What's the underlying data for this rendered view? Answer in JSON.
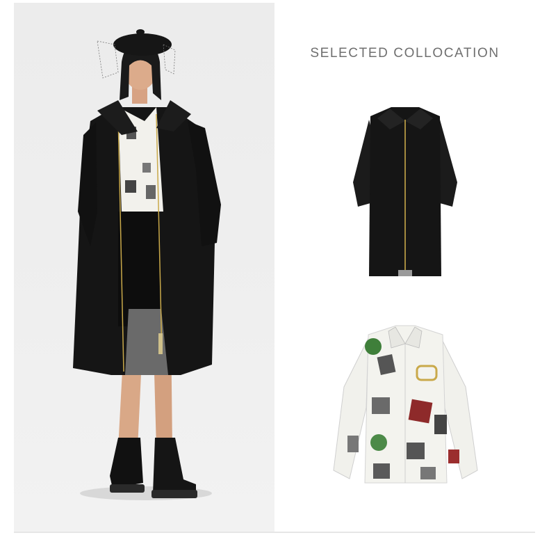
{
  "page": {
    "background": "#ffffff",
    "panel_background": "#eeeeee"
  },
  "collocation": {
    "title": "SELECTED COLLOCATION",
    "title_color": "#6f6f6f",
    "items": [
      {
        "icon": "black-zip-coat-icon"
      },
      {
        "icon": "printed-shirt-icon"
      }
    ]
  },
  "model_photo": {
    "icon": "model-outfit-illustration"
  }
}
